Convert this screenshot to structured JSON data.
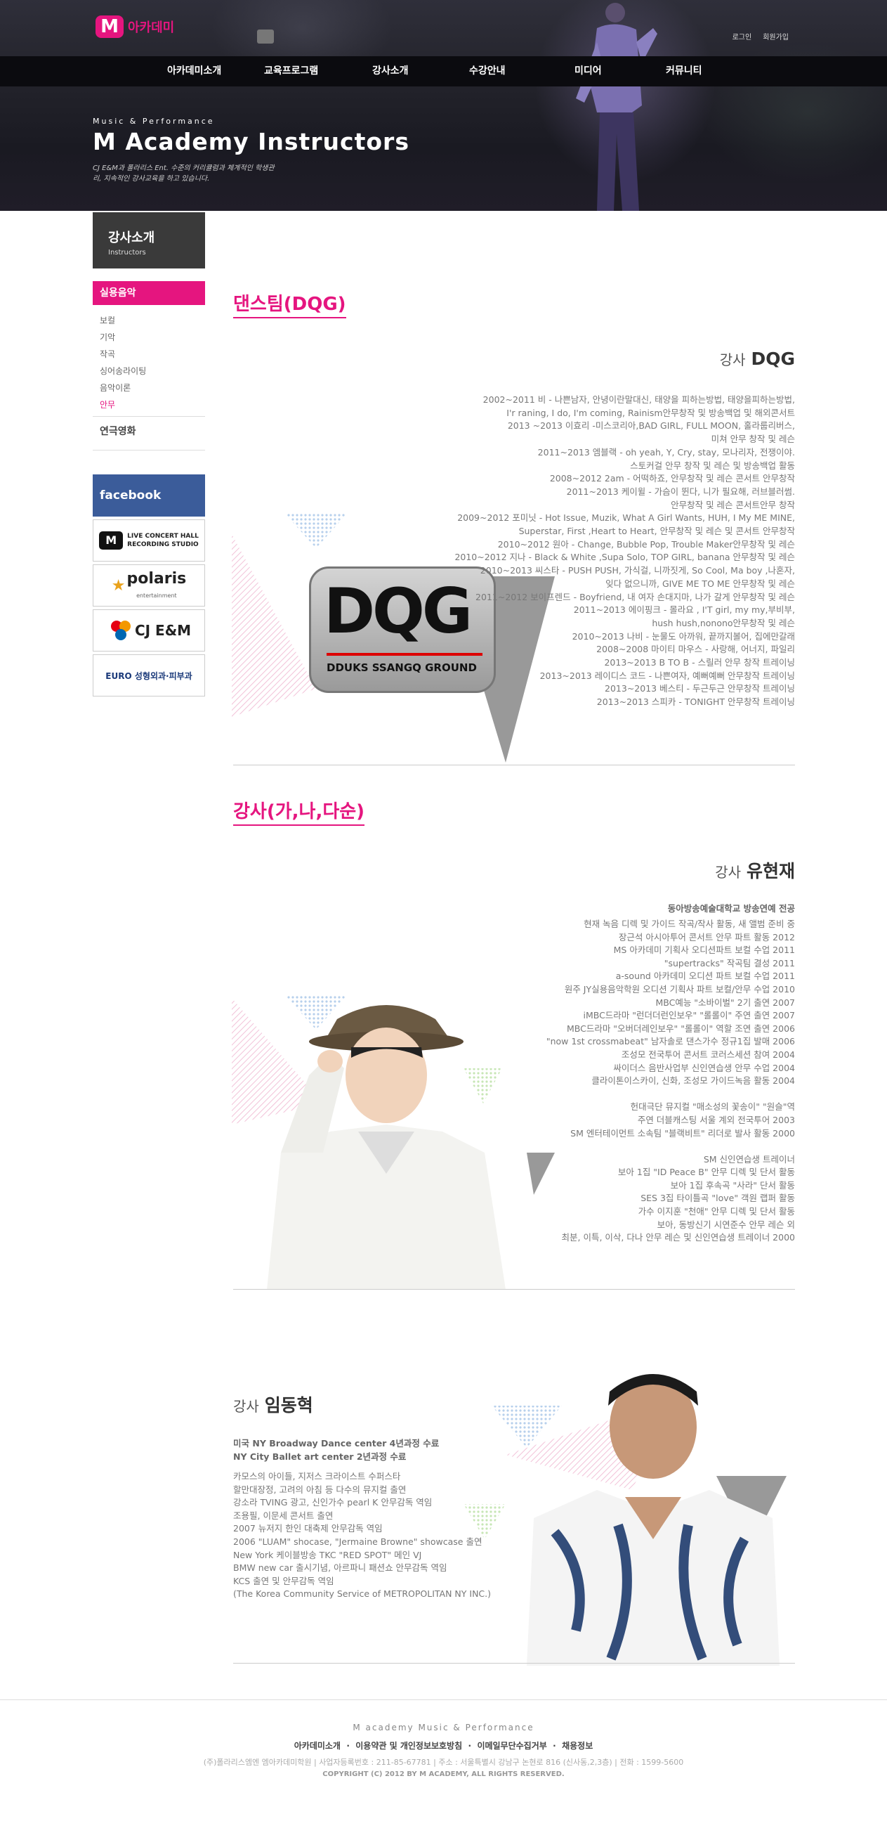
{
  "logo_text": "아카데미",
  "util": {
    "login": "로그인",
    "join": "회원가입"
  },
  "nav": [
    "아카데미소개",
    "교육프로그램",
    "강사소개",
    "수강안내",
    "미디어",
    "커뮤니티"
  ],
  "hero": {
    "sub1": "Music & Performance",
    "title": "M Academy Instructors",
    "desc": "CJ E&M과 폴라리스 Ent. 수준의 커리큘럼과 체계적인 학생관리, 지속적인 강사교육을 하고 있습니다."
  },
  "side": {
    "title": "강사소개",
    "subtitle": "Instructors",
    "cat1": "실용음악",
    "items": [
      "보컬",
      "기악",
      "작곡",
      "싱어송라이팅",
      "음악이론",
      "안무"
    ],
    "cat2": "연극영화"
  },
  "banners": {
    "facebook": "facebook",
    "live": "LIVE CONCERT HALL",
    "live2": "RECORDING STUDIO",
    "polaris": "polaris",
    "polaris2": "entertainment",
    "cj": "CJ E&M",
    "euro": "EURO 성형외과·피부과"
  },
  "sec1": "댄스팀(DQG)",
  "dqg": {
    "prefix": "강사",
    "name": "DQG",
    "logo": "DQG",
    "logo_sub": "DDUKS SSANGQ GROUND",
    "lines": [
      "2002~2011 비 - 나쁜남자, 안녕이란말대신, 태양을 피하는방법, 태양을피하는방법,",
      "I'r raning, I do, I'm coming, Rainism안무창작 및 방송백업 및 해외콘서트",
      "2013 ~2013 이효리 -미스코리아,BAD GIRL, FULL MOON, 홀라룹리버스,",
      "미쳐 안무 창작 및 레슨",
      "2011~2013 엠블랙 - oh yeah, Y, Cry, stay, 모나리자, 전쟁이야.",
      "스토커걸 안무 창작 및 레슨 및 방송백업 활동",
      "2008~2012 2am - 어떡하죠, 안무창작 및 레슨 콘서트 안무창작",
      "2011~2013 케이윌 - 가슴이 뛴다, 니가 필요해, 러브블러썸.",
      "안무창작 및 레슨 콘서트안무 창작",
      "2009~2012 포미닛 - Hot Issue, Muzik, What A Girl Wants, HUH, I My ME MINE,",
      "Superstar, First ,Heart to Heart, 안무창작 및 레슨 및 콘서트 안무창작",
      "2010~2012 원아 - Change, Bubble Pop, Trouble Maker안무창작 및 레슨",
      "2010~2012 지나 - Black & White ,Supa Solo, TOP GIRL, banana 안무창작 및 레슨",
      "2010~2013 씨스타 - PUSH PUSH, 가식걸, 니까짓게, So Cool, Ma boy ,나혼자,",
      "잊다 없으니까, GIVE ME TO ME 안무창작 및 레슨",
      "2011~2012 보이프렌드 - Boyfriend, 내 여자 손대지마, 나가 갈게 안무창작 및 레슨",
      "2011~2013 에이핑크 - 몰라요 , I'T girl, my my,부비부,",
      "hush hush,nonono안무창작 및 레슨",
      "2010~2013 나비 - 눈물도 아까워, 끝까지볼어, 집에만갈래",
      "2008~2008 마이티 마우스 - 사랑해, 어너지, 파일리",
      "2013~2013 B TO B - 스릴러 안무 창작 트레이닝",
      "2013~2013 레이디스 코드 - 나쁜여자, 예뻐예뻐 안무창작 트레이닝",
      "2013~2013 베스티 - 두근두근 안무창작 트레이닝",
      "2013~2013 스피카 - TONIGHT 안무창작 트레이닝"
    ]
  },
  "sec2": "강사(가,나,다순)",
  "yoo": {
    "prefix": "강사",
    "name": "유현재",
    "head": "동아방송예술대학교 방송연예 전공",
    "lines": [
      "현재 녹음 디렉 및 가이드 작곡/작사 활동, 새 앨범 준비 중",
      "장근석 아시아투어 콘서트 안무 파트 활동 2012",
      "MS 아카데미 기획사 오디션파트 보컬 수업 2011",
      "\"supertracks\" 작곡팀 결성 2011",
      "a-sound 아카데미 오디션 파트 보컬 수업 2011",
      "원주 JY실용음악학원 오디션 기획사 파트 보컬/안무 수업 2010",
      "MBC예능 \"소바이벌\" 2기 출연 2007",
      "iMBC드라마 \"런더더런인보우\" \"롤롤이\" 주연 출연 2007",
      "MBC드라마 \"오버더레인보우\" \"롤롤이\" 역할 조연 출연 2006",
      "\"now 1st crossmabeat\" 남자솔로 댄스가수 정규1집 발매 2006",
      "조성모 전국투어 콘서트 코러스세션 참여 2004",
      "싸이더스 음반사업부 신인연습생 안무 수업 2004",
      "클라이톤이스카이, 신화, 조성모 가이드녹음 활동 2004",
      "",
      "헌대극단 뮤지컬 \"매소성의 꽃송이\" \"원슬\"역",
      "주연 더블캐스팅 서울 계외 전국투어 2003",
      "SM 엔터테이먼트 소속팀 \"블랙비트\" 리더로 발사 활동 2000",
      "",
      "SM 신인연습생 트레이너",
      "보아 1집 \"ID Peace B\" 안무 디렉 및 단서 활동",
      "보아 1집 후속곡 \"사라\" 단서 활동",
      "SES 3집 타이틀곡 \"love\" 객원 랩퍼 활동",
      "가수 이지훈 \"천애\" 안무 디렉 및 단서 활동",
      "보아, 동방신기 시연준수 안무 레슨 외",
      "최분, 이특, 이삭, 다나 안무 레슨 및 신인연습생 트레이너 2000"
    ]
  },
  "lim": {
    "prefix": "강사",
    "name": "임동혁",
    "head1": "미국 NY Broadway Dance center 4년과정 수료",
    "head2": "NY City Ballet art center 2년과정 수료",
    "lines": [
      "카모스의 아이들, 지저스 크라이스트 수퍼스타",
      "할만대장정, 고려의 아침 등 다수의 뮤지컬 출연",
      "강소라 TVING 광고, 신인가수 pearl K 안무감독 역임",
      "조용필, 이문세 콘서트 출연",
      "2007 뉴저지 한인 대축제 안무감독 역임",
      "2006 \"LUAM\" shocase, \"Jermaine Browne\" showcase 출연",
      "New York 케이블방송 TKC \"RED SPOT\" 메인 VJ",
      "BMW new car 출시기념, 아르파니 패션쇼 안무감독 역임",
      "KCS 출연 및 안무감독 역임",
      "(The Korea Community Service of METROPOLITAN NY INC.)"
    ]
  },
  "footer": {
    "brand": "M academy Music & Performance",
    "links": [
      "아카데미소개",
      "이용약관 및 개인정보보호방침",
      "이메일무단수집거부",
      "채용정보"
    ],
    "address": "(주)폴라리스엠엔 엠아카데미학원 | 사업자등록번호 : 211-85-67781 | 주소 : 서울특별시 강남구 논현로 816 (신사동,2,3층) | 전화 : 1599-5600",
    "copyright": "COPYRIGHT (C) 2012 BY M ACADEMY, ALL RIGHTS RESERVED."
  }
}
